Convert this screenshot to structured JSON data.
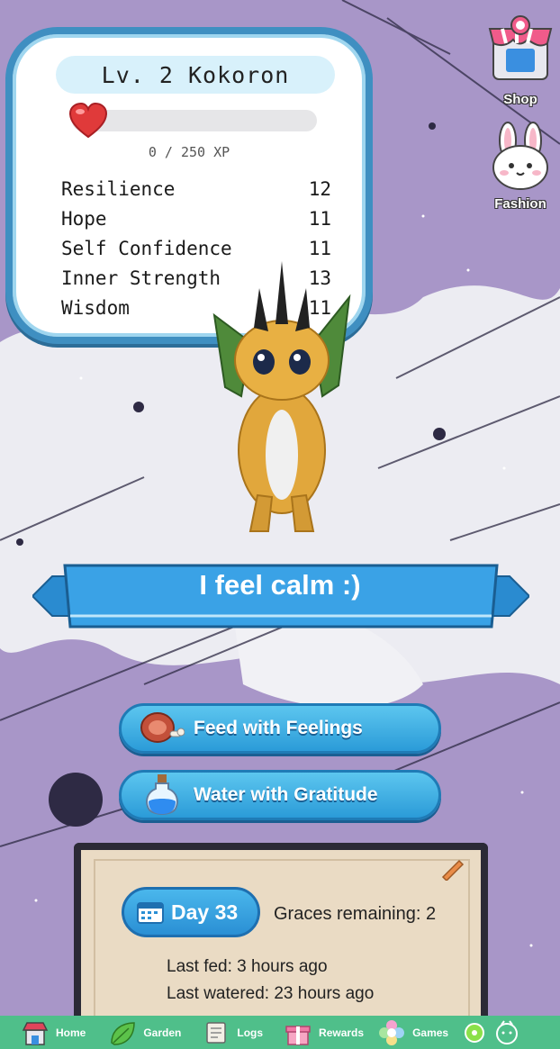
{
  "stats_card": {
    "title": "Lv. 2 Kokoron",
    "xp_text": "0 / 250 XP",
    "xp_fraction": 0,
    "stats": [
      {
        "name": "Resilience",
        "value": "12"
      },
      {
        "name": "Hope",
        "value": "11"
      },
      {
        "name": "Self Confidence",
        "value": "11"
      },
      {
        "name": "Inner Strength",
        "value": "13"
      },
      {
        "name": "Wisdom",
        "value": "11"
      }
    ]
  },
  "side": {
    "shop_label": "Shop",
    "fashion_label": "Fashion"
  },
  "mood": {
    "text": "I feel calm :)"
  },
  "actions": {
    "feed_label": "Feed with Feelings",
    "water_label": "Water with Gratitude"
  },
  "journal": {
    "day_label": "Day 33",
    "graces": "Graces remaining: 2",
    "last_fed": "Last fed: 3 hours ago",
    "last_watered": "Last watered: 23 hours ago"
  },
  "nav": {
    "items": [
      {
        "label": "Home",
        "icon": "home-icon"
      },
      {
        "label": "Garden",
        "icon": "leaf-icon"
      },
      {
        "label": "Logs",
        "icon": "scroll-icon"
      },
      {
        "label": "Rewards",
        "icon": "gift-icon"
      },
      {
        "label": "Games",
        "icon": "flower-icon"
      }
    ]
  },
  "colors": {
    "accent_blue": "#2b9bd8",
    "card_border": "#3f8fc1",
    "nav_green": "#4fbf8a",
    "heart_red": "#e04848"
  }
}
